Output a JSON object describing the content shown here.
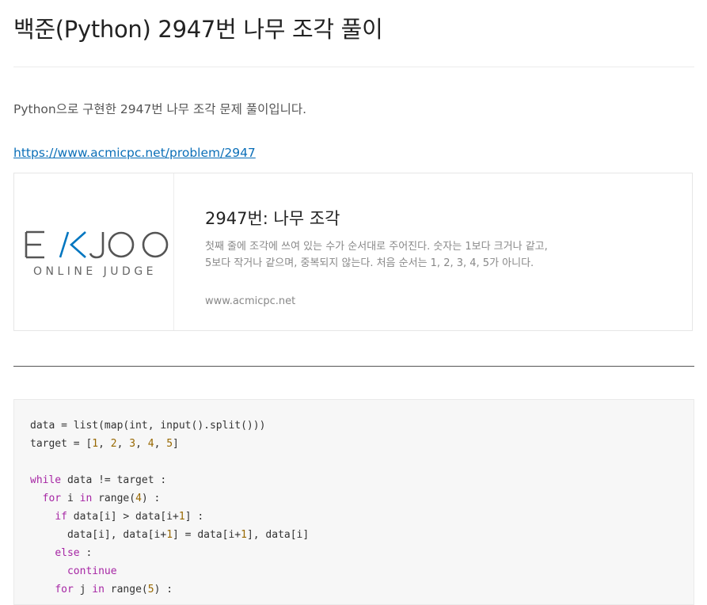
{
  "post": {
    "title": "백준(Python) 2947번 나무 조각 풀이",
    "intro": "Python으로 구현한 2947번 나무 조각 문제 풀이입니다.",
    "link_text": "https://www.acmicpc.net/problem/2947"
  },
  "link_card": {
    "logo_main": "EKJOO",
    "logo_sub": "ONLINE JUDGE",
    "title": "2947번: 나무 조각",
    "description_lines": [
      "첫째 줄에 조각에 쓰여 있는 수가 순서대로 주어진다. 숫자는 1보다 크거나 같고,",
      "5보다 작거나 같으며, 중복되지 않는다. 처음 순서는 1, 2, 3, 4, 5가 아니다."
    ],
    "url": "www.acmicpc.net",
    "logo_accent_color": "#0076c0"
  },
  "code": {
    "lines": [
      "data = list(map(int, input().split()))",
      "target = [1, 2, 3, 4, 5]",
      "",
      "while data != target :",
      "  for i in range(4) :",
      "    if data[i] > data[i+1] :",
      "      data[i], data[i+1] = data[i+1], data[i]",
      "    else :",
      "      continue",
      "    for j in range(5) :"
    ],
    "keyword_color": "#a626a4",
    "number_color": "#986801"
  }
}
